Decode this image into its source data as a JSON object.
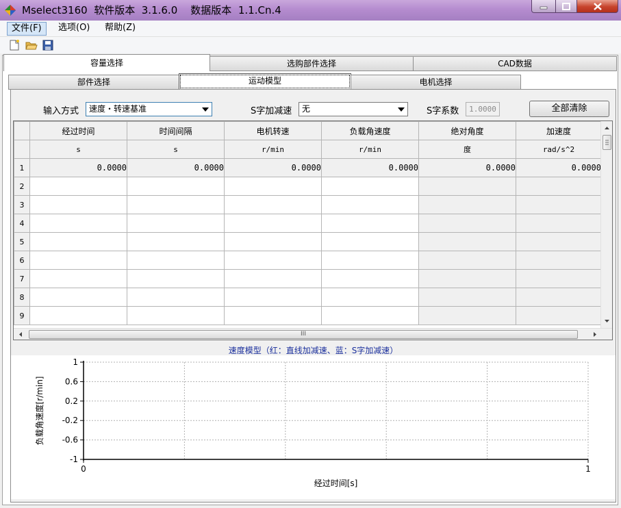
{
  "window": {
    "title": "Mselect3160  软件版本  3.1.6.0    数据版本  1.1.Cn.4"
  },
  "menu": {
    "items": [
      {
        "label": "文件(F)"
      },
      {
        "label": "选项(O)"
      },
      {
        "label": "帮助(Z)"
      }
    ]
  },
  "toolbar": {
    "icons": [
      "new-file-icon",
      "open-folder-icon",
      "save-icon"
    ]
  },
  "tabs": {
    "top": [
      {
        "label": "容量选择",
        "selected": true
      },
      {
        "label": "选购部件选择",
        "selected": false
      },
      {
        "label": "CAD数据",
        "selected": false
      }
    ],
    "sub": [
      {
        "label": "部件选择",
        "selected": false
      },
      {
        "label": "运动模型",
        "selected": true
      },
      {
        "label": "电机选择",
        "selected": false
      }
    ]
  },
  "form": {
    "input_mode_label": "输入方式",
    "input_mode_value": "速度・转速基准",
    "s_curve_label": "S字加减速",
    "s_curve_value": "无",
    "s_coef_label": "S字系数",
    "s_coef_value": "1.0000",
    "clear_all_label": "全部清除"
  },
  "grid": {
    "headers": [
      "经过时间",
      "时间间隔",
      "电机转速",
      "负载角速度",
      "绝对角度",
      "加速度"
    ],
    "units": [
      "s",
      "s",
      "r/min",
      "r/min",
      "度",
      "rad/s^2"
    ],
    "rows": [
      {
        "num": "1",
        "cells": [
          "0.0000",
          "0.0000",
          "0.0000",
          "0.0000",
          "0.0000",
          "0.0000"
        ]
      },
      {
        "num": "2",
        "cells": [
          "",
          "",
          "",
          "",
          "",
          ""
        ]
      },
      {
        "num": "3",
        "cells": [
          "",
          "",
          "",
          "",
          "",
          ""
        ]
      },
      {
        "num": "4",
        "cells": [
          "",
          "",
          "",
          "",
          "",
          ""
        ]
      },
      {
        "num": "5",
        "cells": [
          "",
          "",
          "",
          "",
          "",
          ""
        ]
      },
      {
        "num": "6",
        "cells": [
          "",
          "",
          "",
          "",
          "",
          ""
        ]
      },
      {
        "num": "7",
        "cells": [
          "",
          "",
          "",
          "",
          "",
          ""
        ]
      },
      {
        "num": "8",
        "cells": [
          "",
          "",
          "",
          "",
          "",
          ""
        ]
      },
      {
        "num": "9",
        "cells": [
          "",
          "",
          "",
          "",
          "",
          ""
        ]
      }
    ],
    "hscroll_grip": "III"
  },
  "chart_title": "速度模型（红：直线加减速、蓝：S字加减速）",
  "chart_data": {
    "type": "line",
    "title": "速度模型（红：直线加减速、蓝：S字加减速）",
    "xlabel": "经过时间[s]",
    "ylabel": "负载角速度[r/min]",
    "xlim": [
      0,
      1
    ],
    "ylim": [
      -1,
      1
    ],
    "x_ticks": [
      "0",
      "1"
    ],
    "y_ticks": [
      "1",
      "0.6",
      "0.2",
      "-0.2",
      "-0.6",
      "-1"
    ],
    "grid": true,
    "series": [],
    "colors": {
      "title": "#1a2f9c",
      "linear": "#ff0000",
      "s_curve": "#0000ff"
    }
  }
}
